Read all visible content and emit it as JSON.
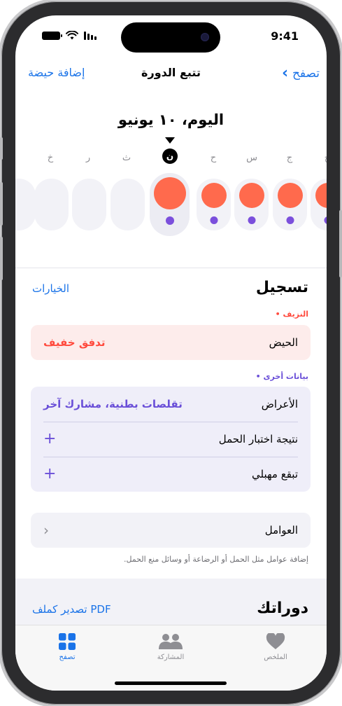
{
  "status": {
    "time": "9:41"
  },
  "nav": {
    "back_label": "تصفح",
    "title": "تتبع الدورة",
    "add_label": "إضافة حيضة"
  },
  "date_title": "اليوم، ١٠ يونيو",
  "calendar": {
    "today_letter": "ن",
    "days": [
      "ج",
      "ج",
      "س",
      "ح",
      "ن",
      "ث",
      "ر",
      "خ"
    ]
  },
  "logging": {
    "title": "تسجيل",
    "options_label": "الخيارات",
    "bleeding_category": "• النزيف",
    "period_label": "الحيض",
    "period_value": "تدفق خفيف",
    "other_category": "• بيانات أخرى",
    "symptoms_label": "الأعراض",
    "symptoms_value": "تقلصات بطنية، مشارك آخر",
    "pregnancy_label": "نتيجة اختبار الحمل",
    "spotting_label": "تبقع مهبلي",
    "factors_label": "العوامل",
    "factors_note": "إضافة عوامل مثل الحمل أو الرضاعة أو وسائل منع الحمل."
  },
  "cycles": {
    "title": "دوراتك",
    "export_label": "تصدير كملف PDF"
  },
  "tabs": [
    {
      "label": "الملخص"
    },
    {
      "label": "المشاركة"
    },
    {
      "label": "تصفح"
    }
  ],
  "colors": {
    "accent": "#1a73e8",
    "flow": "#ff6a4d",
    "purple": "#7b4fdc",
    "bleeding_text": "#ff4a3d"
  }
}
